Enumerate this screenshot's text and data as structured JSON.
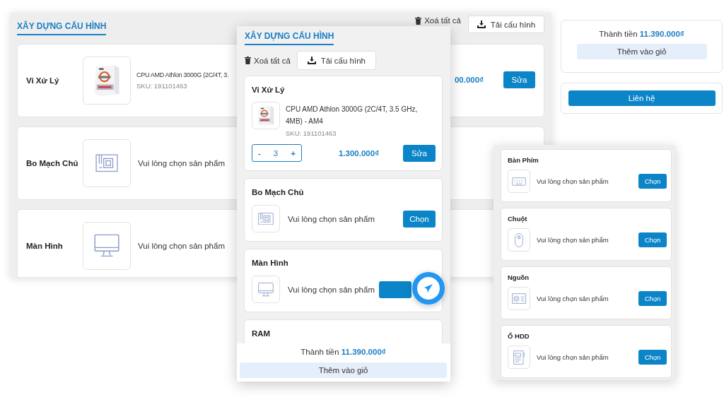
{
  "desktop": {
    "title": "XÂY DỰNG CẤU HÌNH",
    "clear_all": "Xoá tất cả",
    "download": "Tải cấu hình",
    "rows": [
      {
        "kind": "product",
        "label": "Vi Xử Lý",
        "name": "CPU AMD Athlon 3000G (2C/4T, 3.",
        "sku": "SKU: 191101463",
        "price": "00.000₫",
        "action": "Sửa"
      },
      {
        "kind": "motherboard",
        "label": "Bo Mạch Chủ",
        "message": "Vui lòng chọn sản phẩm"
      },
      {
        "kind": "monitor",
        "label": "Màn Hình",
        "message": "Vui lòng chọn sản phẩm"
      }
    ]
  },
  "summary": {
    "total": "Thành tiền **11.390.000₫**",
    "add_to_cart": "Thêm vào giỏ",
    "contact": "Liên hệ"
  },
  "mobile": {
    "title": "XÂY DỰNG CẤU HÌNH",
    "clear_all": "Xoá tất cả",
    "download": "Tải cấu hình",
    "cards": [
      {
        "kind": "product",
        "label": "Vi Xử Lý",
        "name": "CPU AMD Athlon 3000G (2C/4T, 3.5 GHz, 4MB) - AM4",
        "sku": "SKU: 191101463",
        "quantity": {
          "minus": "-",
          "value": "3",
          "plus": "+"
        },
        "price": "1.300.000₫",
        "action": "Sửa"
      },
      {
        "kind": "motherboard",
        "label": "Bo Mạch Chủ",
        "message": "Vui lòng chọn sản phẩm",
        "action": "Chọn"
      },
      {
        "kind": "monitor",
        "label": "Màn Hình",
        "message": "Vui lòng chọn sản phẩm"
      },
      {
        "kind": "ram",
        "label": "RAM"
      }
    ],
    "total": "Thành tiền **11.390.000₫**",
    "add_to_cart": "Thêm vào giỏ"
  },
  "accessories": {
    "cards": [
      {
        "kind": "keyboard",
        "label": "Bàn Phím",
        "message": "Vui lòng chọn sản phẩm",
        "action": "Chọn"
      },
      {
        "kind": "mouse",
        "label": "Chuột",
        "message": "Vui lòng chọn sản phẩm",
        "action": "Chọn"
      },
      {
        "kind": "psu",
        "label": "Nguồn",
        "message": "Vui lòng chọn sản phẩm",
        "action": "Chọn"
      },
      {
        "kind": "hdd",
        "label": "Ổ HDD",
        "message": "Vui lòng chọn sản phẩm",
        "action": "Chọn"
      }
    ]
  }
}
